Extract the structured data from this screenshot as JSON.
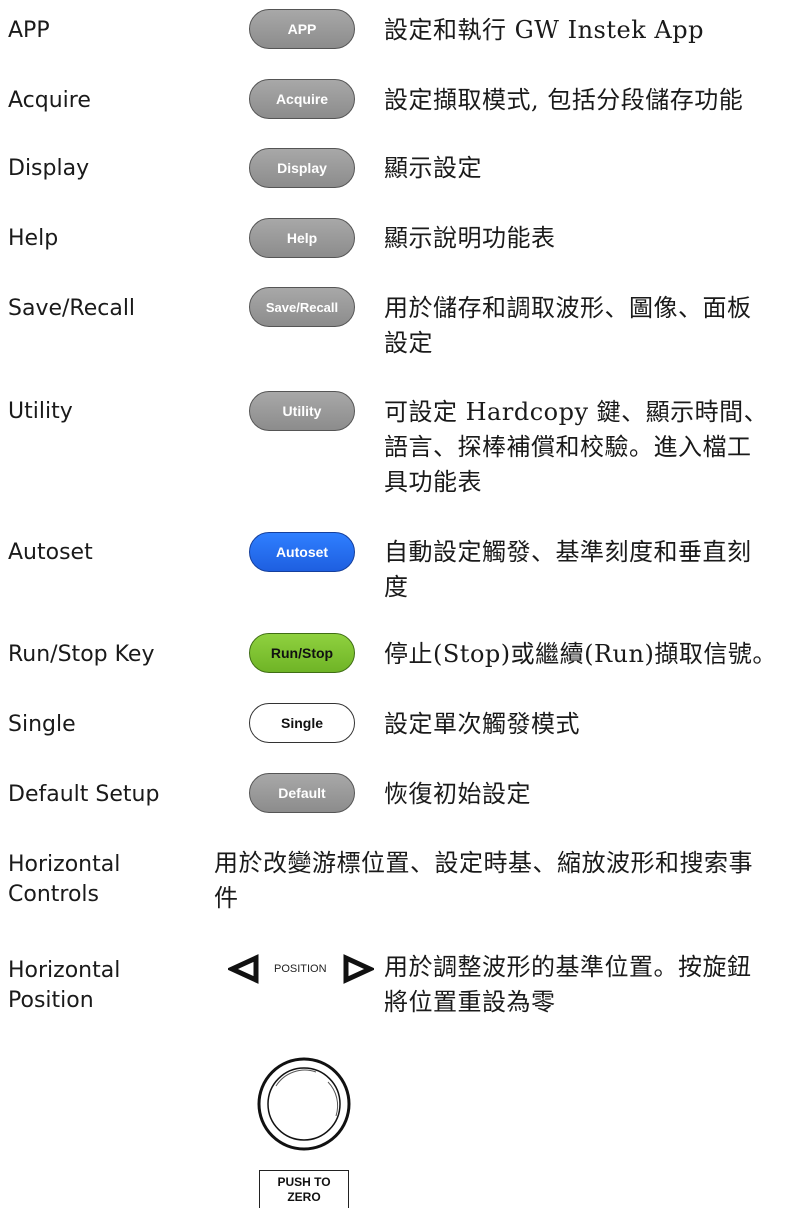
{
  "rows": [
    {
      "label": "APP",
      "key": "APP",
      "desc": "設定和執行 GW Instek App"
    },
    {
      "label": "Acquire",
      "key": "Acquire",
      "desc": "設定擷取模式, 包括分段儲存功能"
    },
    {
      "label": "Display",
      "key": "Display",
      "desc": "顯示設定"
    },
    {
      "label": "Help",
      "key": "Help",
      "desc": "顯示說明功能表"
    },
    {
      "label": "Save/Recall",
      "key": "Save/Recall",
      "desc_lines": [
        "用於儲存和調取波形、圖像、面板",
        "設定"
      ]
    },
    {
      "label": "Utility",
      "key": "Utility",
      "desc_lines": [
        "可設定 Hardcopy 鍵、顯示時間、",
        "語言、探棒補償和校驗。進入檔工",
        "具功能表"
      ]
    },
    {
      "label": "Autoset",
      "key": "Autoset",
      "desc_lines": [
        "自動設定觸發、基準刻度和垂直刻",
        "度"
      ]
    },
    {
      "label": "Run/Stop Key",
      "key": "Run/Stop",
      "desc": "停止(Stop)或繼續(Run)擷取信號。"
    },
    {
      "label": "Single",
      "key": "Single",
      "desc": "設定單次觸發模式"
    },
    {
      "label": "Default Setup",
      "key": "Default",
      "desc": "恢復初始設定"
    }
  ],
  "horizontal_controls": {
    "label_lines": [
      "Horizontal",
      "Controls"
    ],
    "desc_lines": [
      "用於改變游標位置、設定時基、縮放波形和搜索事",
      "件"
    ]
  },
  "horizontal_position": {
    "label_lines": [
      "Horizontal",
      "Position"
    ],
    "knob_caption": "POSITION",
    "push_lines": [
      "PUSH TO",
      "ZERO"
    ],
    "desc_lines": [
      "用於調整波形的基準位置。按旋鈕",
      "將位置重設為零"
    ]
  },
  "colors": {
    "autoset": "#2f7fff",
    "runstop": "#8fd13f",
    "gray_key": "#9a9a9a"
  }
}
